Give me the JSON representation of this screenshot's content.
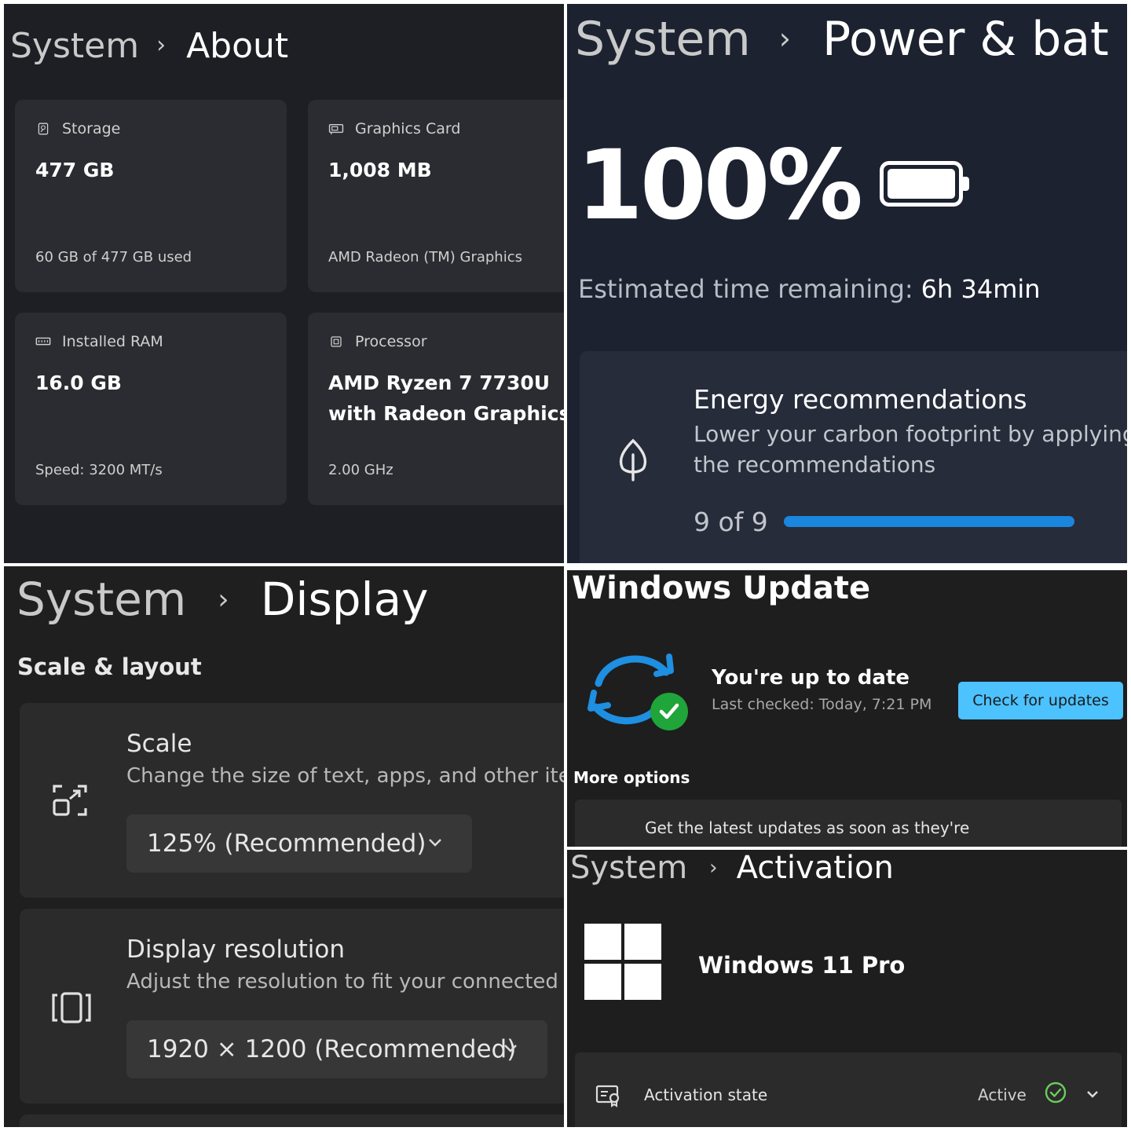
{
  "about": {
    "breadcrumb": {
      "parent": "System",
      "separator": "›",
      "page": "About"
    },
    "cards": {
      "storage": {
        "label": "Storage",
        "icon": "storage-icon",
        "value": "477 GB",
        "footer": "60 GB of 477 GB used"
      },
      "graphics": {
        "label": "Graphics Card",
        "icon": "graphics-card-icon",
        "value": "1,008 MB",
        "footer": "AMD Radeon (TM) Graphics"
      },
      "ram": {
        "label": "Installed RAM",
        "icon": "ram-icon",
        "value": "16.0 GB",
        "footer": "Speed: 3200 MT/s"
      },
      "processor": {
        "label": "Processor",
        "icon": "processor-icon",
        "value_line1": "AMD Ryzen 7 7730U",
        "value_line2": "with Radeon Graphics",
        "footer": "2.00 GHz"
      }
    }
  },
  "power": {
    "breadcrumb": {
      "parent": "System",
      "separator": "›",
      "page": "Power & bat"
    },
    "battery_percent_text": "100%",
    "battery_level": 1.0,
    "estimate_label": "Estimated time remaining:",
    "estimate_value": "6h 34min",
    "energy": {
      "title": "Energy recommendations",
      "description": "Lower your carbon footprint by applying the recommendations",
      "count_text": "9 of 9",
      "progress": 1.0,
      "accent": "#1a86dd"
    }
  },
  "display": {
    "breadcrumb": {
      "parent": "System",
      "separator": "›",
      "page": "Display"
    },
    "section": "Scale & layout",
    "scale": {
      "title": "Scale",
      "description": "Change the size of text, apps, and other items",
      "value": "125% (Recommended)"
    },
    "resolution": {
      "title": "Display resolution",
      "description": "Adjust the resolution to fit your connected display",
      "value": "1920 × 1200 (Recommended)"
    }
  },
  "update": {
    "title": "Windows Update",
    "status": "You're up to date",
    "last_checked": "Last checked: Today, 7:21 PM",
    "check_button": "Check for updates",
    "accent": "#4cc2ff",
    "more_options": "More options",
    "option_text": "Get the latest updates as soon as they're"
  },
  "activation": {
    "breadcrumb": {
      "parent": "System",
      "separator": "›",
      "page": "Activation"
    },
    "edition": "Windows 11 Pro",
    "state_label": "Activation state",
    "state_value": "Active",
    "state_color": "#6ccb5f"
  }
}
